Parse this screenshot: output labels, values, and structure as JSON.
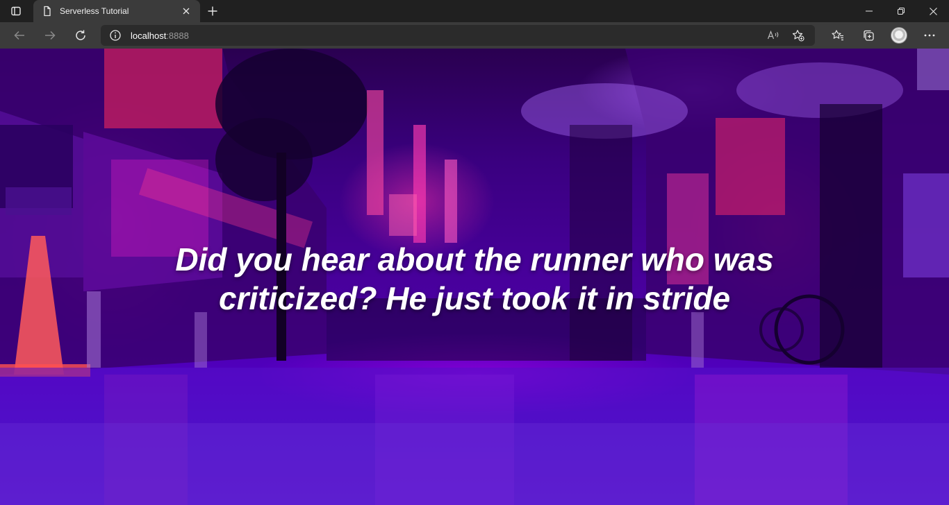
{
  "browser": {
    "tab": {
      "title": "Serverless Tutorial"
    },
    "address": {
      "host": "localhost",
      "port": ":8888"
    },
    "colors": {
      "chrome": "#202020",
      "toolbar": "#3b3b3b",
      "omnibox": "#2b2b2b"
    },
    "icons": {
      "tab_actions": "tab-actions-icon",
      "tab_favicon": "document-icon",
      "tab_close": "close-icon",
      "new_tab": "plus-icon",
      "back": "back-arrow-icon",
      "forward": "forward-arrow-icon",
      "reload": "reload-icon",
      "site_info": "info-icon",
      "read_aloud": "read-aloud-icon",
      "add_favorite": "add-favorite-icon",
      "favorites": "favorites-icon",
      "collections": "collections-icon",
      "profile": "profile-avatar",
      "menu": "more-menu-icon",
      "minimize": "minimize-icon",
      "restore": "restore-icon",
      "close_window": "close-icon"
    }
  },
  "page": {
    "joke": "Did you hear about the runner who was criticized? He just took it in stride",
    "background": {
      "description_colors": {
        "top": "#2a0050",
        "middle": "#4a00a0",
        "street": "#5000c0",
        "neon_pink": "#ff2a8a",
        "neon_magenta": "#dc28c8"
      }
    }
  }
}
